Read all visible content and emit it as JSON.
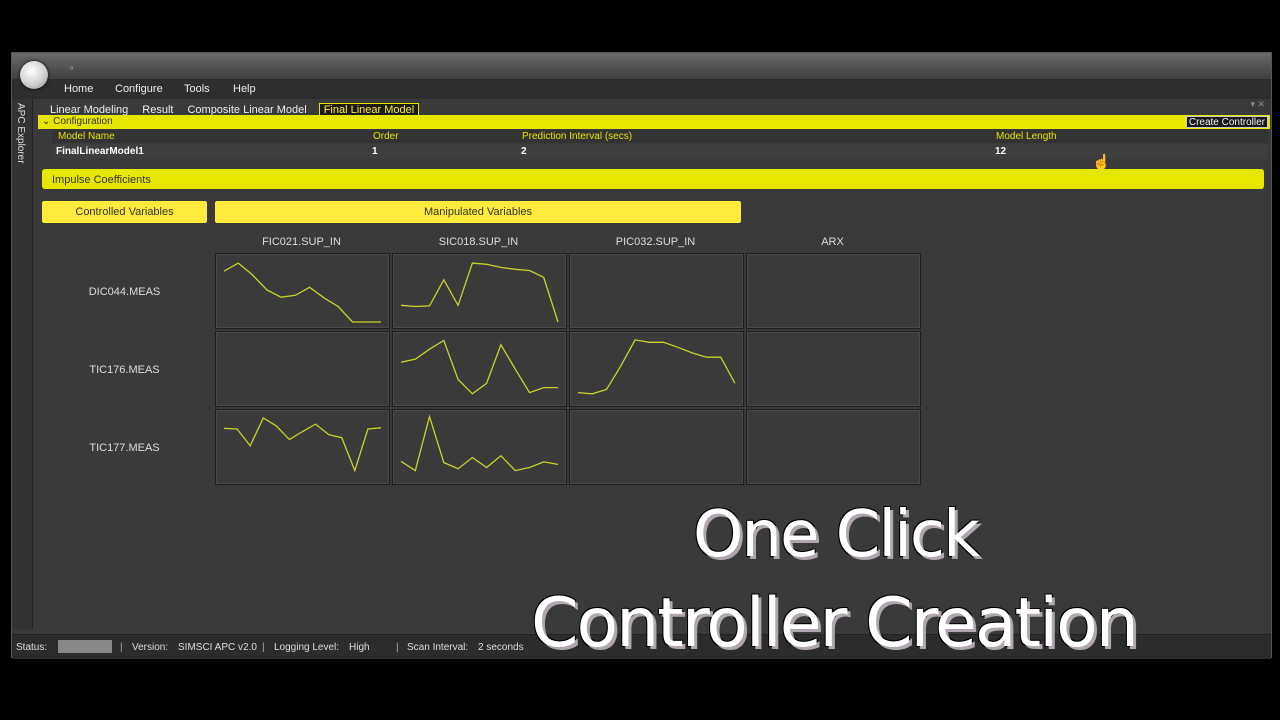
{
  "menu": [
    "Home",
    "Configure",
    "Tools",
    "Help"
  ],
  "quick_access_glyph": "▫",
  "sidebar": {
    "label": "APC Explorer"
  },
  "tabs": [
    {
      "label": "Linear Modeling",
      "active": false
    },
    {
      "label": "Result",
      "active": false
    },
    {
      "label": "Composite Linear Model",
      "active": false
    },
    {
      "label": "Final Linear Model",
      "active": true
    }
  ],
  "tab_controls": "▾ ✕",
  "configuration": {
    "label": "Configuration",
    "chevron": "⌄",
    "create_button": "Create Controller",
    "columns": [
      "Model Name",
      "Order",
      "Prediction Interval (secs)",
      "Model Length"
    ],
    "row": [
      "FinalLinearModel1",
      "1",
      "2",
      "12"
    ]
  },
  "cursor_glyph": "☝",
  "impulse": {
    "label": "Impulse Coefficients",
    "controlled_button": "Controlled Variables",
    "manipulated_button": "Manipulated Variables",
    "columns": [
      "FIC021.SUP_IN",
      "SIC018.SUP_IN",
      "PIC032.SUP_IN",
      "ARX"
    ],
    "rows": [
      "DIC044.MEAS",
      "TIC176.MEAS",
      "TIC177.MEAS"
    ],
    "line_color": "#c8d22a",
    "curves": [
      [
        [
          0.82,
          0.95,
          0.76,
          0.52,
          0.4,
          0.43,
          0.56,
          0.39,
          0.25,
          0.0,
          0.0,
          0.0
        ],
        [
          0.27,
          0.25,
          0.26,
          0.68,
          0.27,
          0.95,
          0.93,
          0.88,
          0.85,
          0.83,
          0.72,
          0.0
        ],
        null,
        null
      ],
      [
        null,
        [
          0.61,
          0.66,
          0.82,
          0.96,
          0.33,
          0.1,
          0.27,
          0.89,
          0.5,
          0.12,
          0.2,
          0.2
        ],
        [
          0.12,
          0.1,
          0.17,
          0.55,
          0.97,
          0.93,
          0.93,
          0.85,
          0.76,
          0.69,
          0.69,
          0.27
        ],
        null
      ],
      [
        [
          0.8,
          0.79,
          0.52,
          0.97,
          0.84,
          0.62,
          0.75,
          0.87,
          0.7,
          0.65,
          0.12,
          0.79,
          0.81
        ],
        [
          0.27,
          0.12,
          0.99,
          0.25,
          0.15,
          0.33,
          0.17,
          0.36,
          0.12,
          0.17,
          0.26,
          0.22
        ],
        null,
        null
      ]
    ]
  },
  "status": {
    "label": "Status:",
    "version_label": "Version:",
    "version": "SIMSCI APC v2.0",
    "logging_label": "Logging Level:",
    "logging": "High",
    "scan_label": "Scan Interval:",
    "scan": "2 seconds"
  },
  "overlay": {
    "line1": "One Click",
    "line2": "Controller Creation"
  }
}
